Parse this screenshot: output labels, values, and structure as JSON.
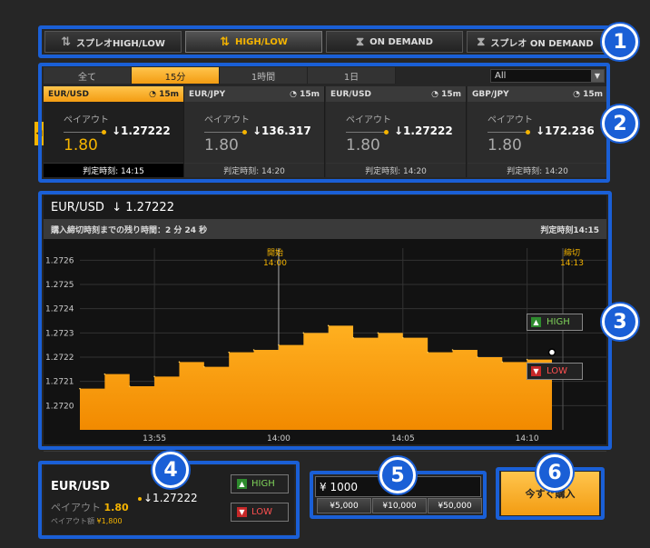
{
  "tabs": [
    {
      "label": "スプレオHIGH/LOW",
      "icon": "updown-arrows-icon",
      "active": false
    },
    {
      "label": "HIGH/LOW",
      "icon": "updown-arrows-icon",
      "active": true
    },
    {
      "label": "ON DEMAND",
      "icon": "hourglass-icon",
      "active": false
    },
    {
      "label": "スプレオ ON DEMAND",
      "icon": "hourglass-icon",
      "active": false
    }
  ],
  "filter_tabs": [
    "全て",
    "15分",
    "1時間",
    "1日"
  ],
  "filter_active": "15分",
  "filter_select": "All",
  "cards": [
    {
      "pair": "EUR/USD",
      "duration": "15m",
      "payout_label": "ペイアウト",
      "payout": "1.80",
      "rate": "↓1.27222",
      "judge": "判定時刻: 14:15"
    },
    {
      "pair": "EUR/JPY",
      "duration": "15m",
      "payout_label": "ペイアウト",
      "payout": "1.80",
      "rate": "↓136.317",
      "judge": "判定時刻: 14:20"
    },
    {
      "pair": "EUR/USD",
      "duration": "15m",
      "payout_label": "ペイアウト",
      "payout": "1.80",
      "rate": "↓1.27222",
      "judge": "判定時刻: 14:20"
    },
    {
      "pair": "GBP/JPY",
      "duration": "15m",
      "payout_label": "ペイアウト",
      "payout": "1.80",
      "rate": "↓172.236",
      "judge": "判定時刻: 14:20"
    }
  ],
  "chart_panel": {
    "pair": "EUR/USD",
    "rate": "↓ 1.27222",
    "remaining": "購入締切時刻までの残り時間：2 分 24 秒",
    "judge": "判定時刻14:15",
    "start_label": "開始",
    "start_time": "14:00",
    "close_label": "締切",
    "close_time": "14:13",
    "high_label": "HIGH",
    "low_label": "LOW"
  },
  "chart_data": {
    "type": "area",
    "title": "EUR/USD",
    "x": [
      "13:52",
      "13:53",
      "13:54",
      "13:55",
      "13:56",
      "13:57",
      "13:58",
      "13:59",
      "14:00",
      "14:01",
      "14:02",
      "14:03",
      "14:04",
      "14:05",
      "14:06",
      "14:07",
      "14:08",
      "14:09",
      "14:10",
      "14:11"
    ],
    "values": [
      1.27207,
      1.27213,
      1.27208,
      1.27212,
      1.27218,
      1.27216,
      1.27222,
      1.27223,
      1.27225,
      1.2723,
      1.27233,
      1.27228,
      1.2723,
      1.27228,
      1.27222,
      1.27223,
      1.2722,
      1.27218,
      1.27219,
      1.27222
    ],
    "xticks": [
      "13:55",
      "14:00",
      "14:05",
      "14:10"
    ],
    "yticks": [
      "1.2726",
      "1.2725",
      "1.2724",
      "1.2723",
      "1.2722",
      "1.2721",
      "1.2720"
    ],
    "ylim": [
      1.2719,
      1.27265
    ],
    "colors": {
      "fill_top": "#ffb020",
      "fill_bottom": "#f28a00"
    }
  },
  "order": {
    "pair": "EUR/USD",
    "payout_label": "ペイアウト",
    "payout": "1.80",
    "rate": "↓1.27222",
    "payout_amount_label": "ペイアウト額",
    "payout_amount": "¥1,800",
    "high_label": "HIGH",
    "low_label": "LOW"
  },
  "amount": {
    "value": "¥ 1000",
    "quick": [
      "¥5,000",
      "¥10,000",
      "¥50,000"
    ]
  },
  "buy_label": "今すぐ購入",
  "callouts": [
    "1",
    "2",
    "3",
    "4",
    "5",
    "6"
  ],
  "accent": "#f5b400",
  "callout_color": "#1a5fd6"
}
